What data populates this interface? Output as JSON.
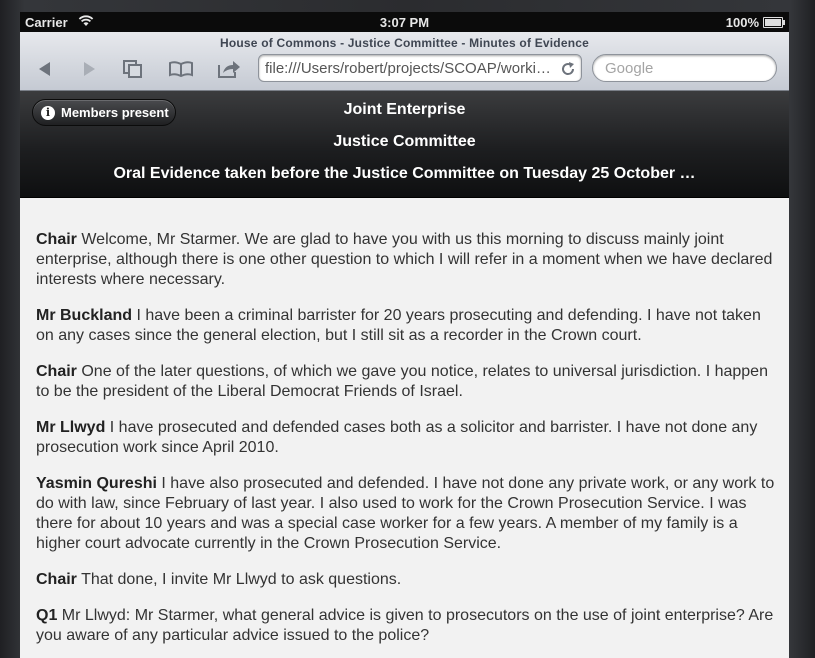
{
  "status_bar": {
    "carrier": "Carrier",
    "time": "3:07 PM",
    "battery": "100%"
  },
  "browser": {
    "page_title": "House of Commons - Justice Committee - Minutes of Evidence",
    "url": "file:///Users/robert/projects/SCOAP/workin…",
    "search_placeholder": "Google",
    "icons": [
      "back-arrow-icon",
      "forward-arrow-icon",
      "tabs-icon",
      "bookmarks-book-icon",
      "share-icon",
      "reload-icon"
    ]
  },
  "header": {
    "members_button": "Members present",
    "line1": "Joint Enterprise",
    "line2": "Justice Committee",
    "line3": "Oral Evidence taken before the Justice Committee on Tuesday 25 October …"
  },
  "content": {
    "paragraphs": [
      {
        "speaker": "Chair",
        "text": " Welcome, Mr Starmer. We are glad to have you with us this morning to discuss mainly joint enterprise, although there is one other question to which I will refer in a moment when we have declared interests where necessary."
      },
      {
        "speaker": "Mr Buckland",
        "text": " I have been a criminal barrister for 20 years prosecuting and defending. I have not taken on any cases since the general election, but I still sit as a recorder in the Crown court."
      },
      {
        "speaker": "Chair",
        "text": " One of the later questions, of which we gave you notice, relates to universal jurisdiction. I happen to be the president of the Liberal Democrat Friends of Israel."
      },
      {
        "speaker": "Mr Llwyd",
        "text": " I have prosecuted and defended cases both as a solicitor and barrister. I have not done any prosecution work since April 2010."
      },
      {
        "speaker": "Yasmin Qureshi",
        "text": " I have also prosecuted and defended. I have not done any private work, or any work to do with law, since February of last year. I also used to work for the Crown Prosecution Service. I was there for about 10 years and was a special case worker for a few years. A member of my family is a higher court advocate currently in the Crown Prosecution Service."
      },
      {
        "speaker": "Chair",
        "text": " That done, I invite Mr Llwyd to ask questions."
      },
      {
        "speaker": "Q1",
        "text": " Mr Llwyd: Mr Starmer, what general advice is given to prosecutors on the use of joint enterprise? Are you aware of any particular advice issued to the police?"
      }
    ]
  }
}
